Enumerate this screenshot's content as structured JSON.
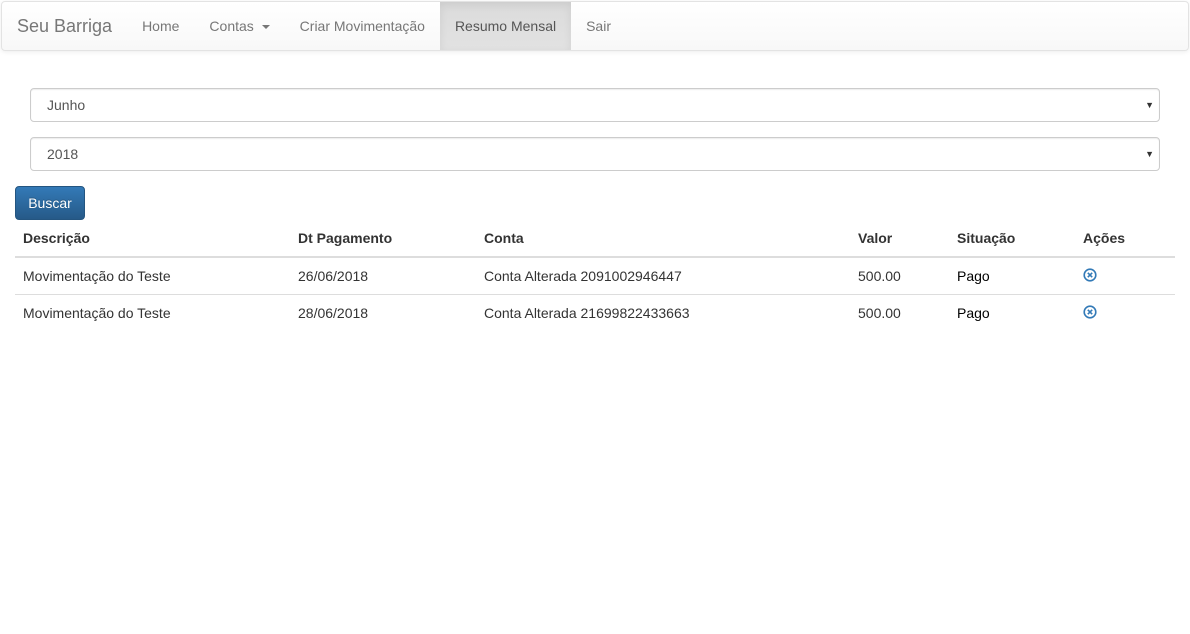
{
  "navbar": {
    "brand": "Seu Barriga",
    "items": [
      {
        "label": "Home"
      },
      {
        "label": "Contas"
      },
      {
        "label": "Criar Movimentação"
      },
      {
        "label": "Resumo Mensal"
      },
      {
        "label": "Sair"
      }
    ],
    "active": "Resumo Mensal"
  },
  "filters": {
    "month": {
      "selected": "Junho"
    },
    "year": {
      "selected": "2018"
    },
    "search_button": "Buscar"
  },
  "table": {
    "headers": [
      "Descrição",
      "Dt Pagamento",
      "Conta",
      "Valor",
      "Situação",
      "Ações"
    ],
    "rows": [
      {
        "descricao": "Movimentação do Teste",
        "dt_pagamento": "26/06/2018",
        "conta": "Conta Alterada 2091002946447",
        "valor": "500.00",
        "situacao": "Pago",
        "action_icon": "remove-circle-icon"
      },
      {
        "descricao": "Movimentação do Teste",
        "dt_pagamento": "28/06/2018",
        "conta": "Conta Alterada 21699822433663",
        "valor": "500.00",
        "situacao": "Pago",
        "action_icon": "remove-circle-icon"
      }
    ]
  },
  "colors": {
    "primary": "#337ab7",
    "nav_text": "#777777",
    "icon": "#337ab7"
  }
}
